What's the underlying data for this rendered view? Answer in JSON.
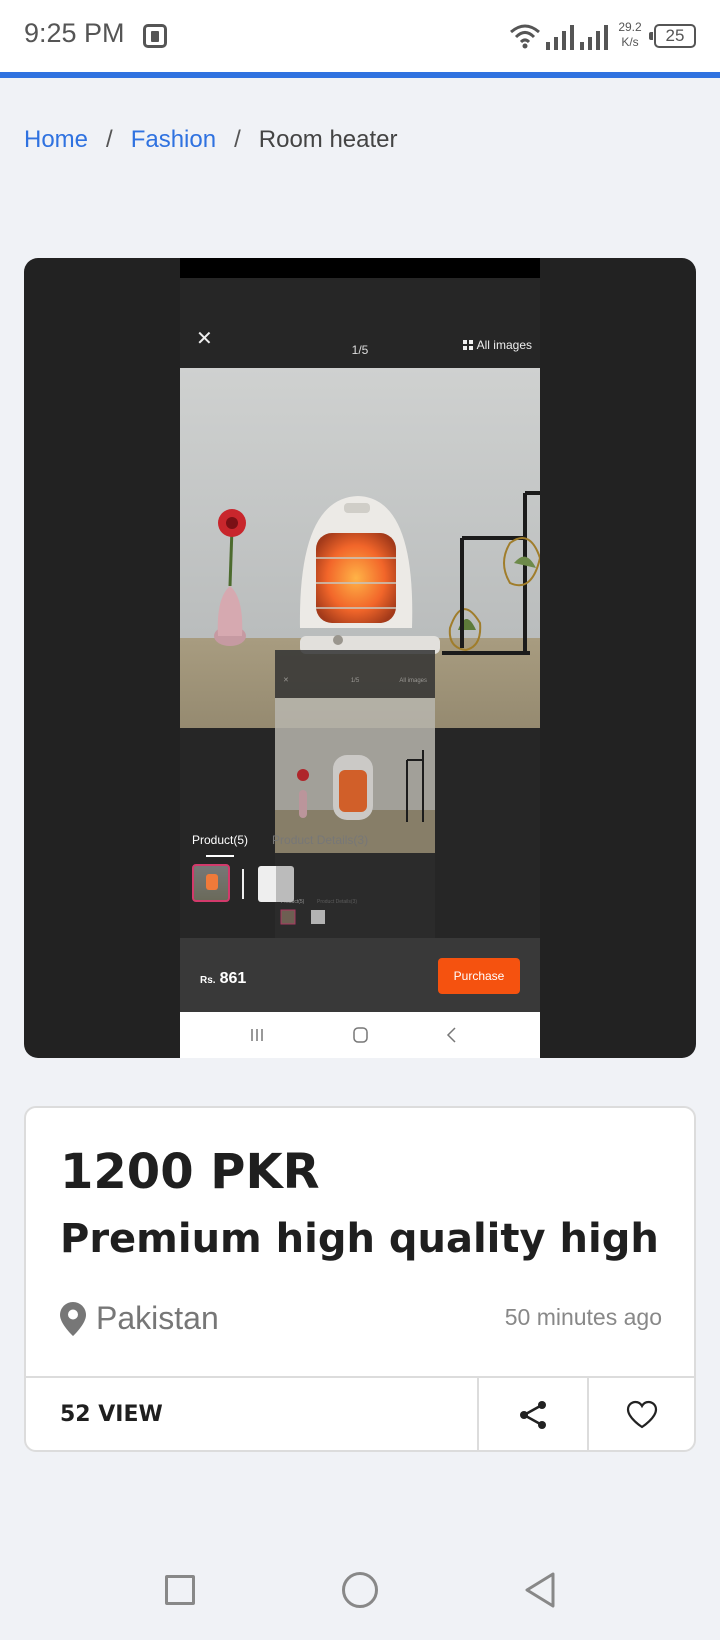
{
  "status_bar": {
    "time": "9:25 PM",
    "speed_value": "29.2",
    "speed_unit": "K/s",
    "battery": "25"
  },
  "breadcrumb": {
    "home": "Home",
    "category": "Fashion",
    "current": "Room heater",
    "separator": "/"
  },
  "product_viewer": {
    "counter": "1/5",
    "all_images": "All images",
    "tab_products": "Product(5)",
    "tab_details": "Product Details(3)",
    "currency": "Rs.",
    "price": "861",
    "purchase": "Purchase"
  },
  "listing": {
    "price": "1200 PKR",
    "title": "Premium high quality high",
    "location": "Pakistan",
    "time_ago": "50 minutes ago",
    "views": "52 VIEW"
  },
  "colors": {
    "accent": "#2f72e0",
    "purchase": "#f5520f",
    "card_bg": "#222222"
  },
  "icons": [
    "recording-icon",
    "wifi-icon",
    "signal-icon",
    "battery-icon",
    "close-icon",
    "grid-icon",
    "location-pin-icon",
    "share-icon",
    "heart-icon",
    "recent-apps-icon",
    "home-icon",
    "back-icon"
  ]
}
